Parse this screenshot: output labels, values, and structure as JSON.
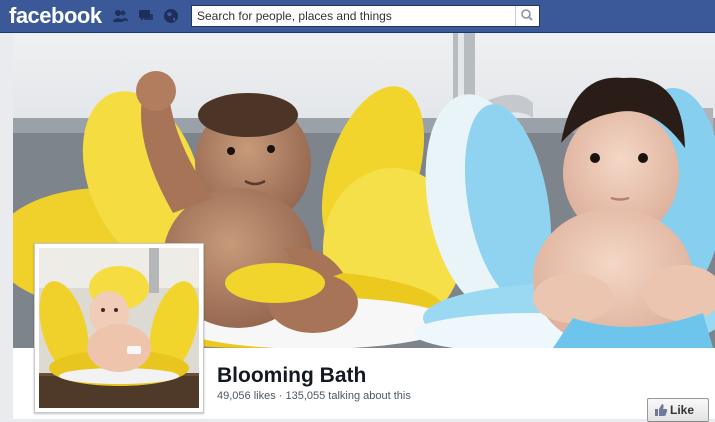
{
  "topbar": {
    "logo_text": "facebook",
    "search_placeholder": "Search for people, places and things",
    "icons": [
      "friend-requests-icon",
      "messages-icon",
      "notifications-globe-icon",
      "search-icon"
    ]
  },
  "page": {
    "name": "Blooming Bath",
    "stats": "49,056 likes · 135,055 talking about this",
    "like_label": "Like"
  },
  "colors": {
    "brand_blue": "#3b5998",
    "flower_yellow": "#f2d526",
    "flower_blue": "#8fd3f0"
  }
}
